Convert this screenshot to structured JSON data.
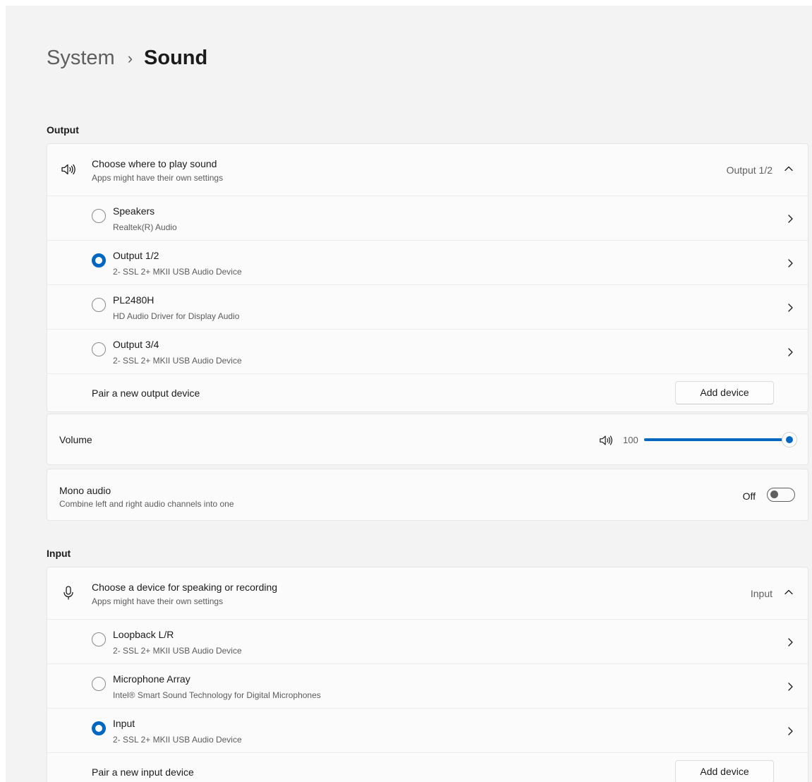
{
  "breadcrumb": {
    "parent": "System",
    "separator": "›",
    "current": "Sound"
  },
  "output": {
    "section_title": "Output",
    "header": {
      "title": "Choose where to play sound",
      "subtitle": "Apps might have their own settings",
      "current_value": "Output 1/2",
      "icon": "speaker-icon",
      "expanded": true
    },
    "devices": [
      {
        "name": "Speakers",
        "description": "Realtek(R) Audio",
        "selected": false
      },
      {
        "name": "Output 1/2",
        "description": "2- SSL 2+ MKII USB Audio Device",
        "selected": true
      },
      {
        "name": "PL2480H",
        "description": "HD Audio Driver for Display Audio",
        "selected": false
      },
      {
        "name": "Output 3/4",
        "description": "2- SSL 2+ MKII USB Audio Device",
        "selected": false
      }
    ],
    "pair": {
      "label": "Pair a new output device",
      "button": "Add device"
    }
  },
  "volume": {
    "label": "Volume",
    "value": "100",
    "level_percent": 100,
    "icon": "speaker-icon"
  },
  "mono_audio": {
    "title": "Mono audio",
    "subtitle": "Combine left and right audio channels into one",
    "state_label": "Off",
    "on": false
  },
  "input": {
    "section_title": "Input",
    "header": {
      "title": "Choose a device for speaking or recording",
      "subtitle": "Apps might have their own settings",
      "current_value": "Input",
      "icon": "microphone-icon",
      "expanded": true
    },
    "devices": [
      {
        "name": "Loopback L/R",
        "description": "2- SSL 2+ MKII USB Audio Device",
        "selected": false
      },
      {
        "name": "Microphone Array",
        "description": "Intel® Smart Sound Technology for Digital Microphones",
        "selected": false
      },
      {
        "name": "Input",
        "description": "2- SSL 2+ MKII USB Audio Device",
        "selected": true
      }
    ],
    "pair": {
      "label": "Pair a new input device",
      "button": "Add device"
    }
  },
  "colors": {
    "accent": "#0067c0",
    "background": "#f3f3f3",
    "card": "#fbfbfb"
  }
}
